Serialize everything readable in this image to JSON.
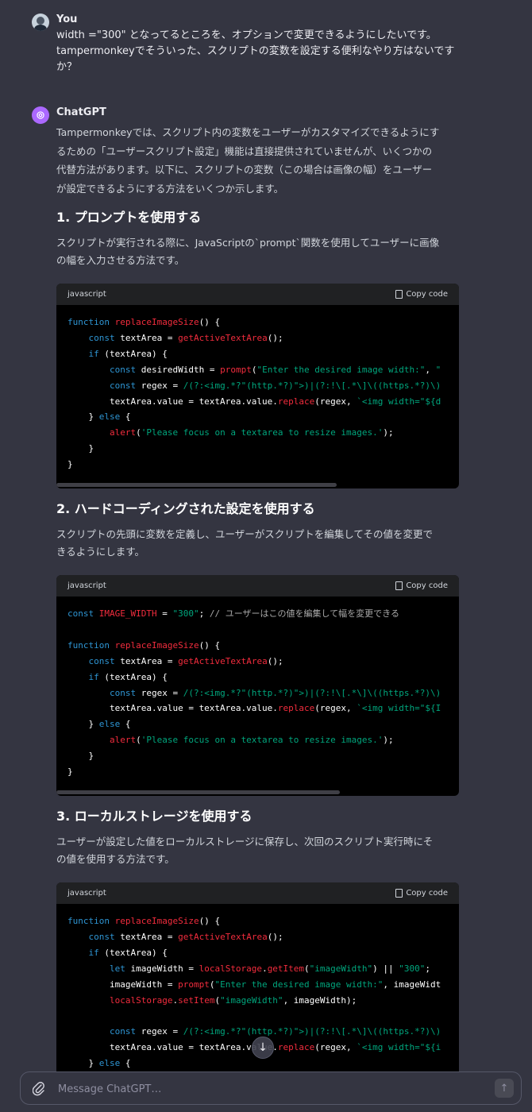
{
  "user_message": {
    "author": "You",
    "lines": [
      "width =\"300\" となってるところを、オプションで変更できるようにしたいです。",
      "tampermonkeyでそういった、スクリプトの変数を設定する便利なやり方はないです",
      "か？"
    ]
  },
  "assistant_message": {
    "author": "ChatGPT",
    "intro_lines": [
      "Tampermonkeyでは、スクリプト内の変数をユーザーがカスタマイズできるようにす",
      "るための「ユーザースクリプト設定」機能は直接提供されていませんが、いくつかの",
      "代替方法があります。以下に、スクリプトの変数（この場合は画像の幅）をユーザー",
      "が設定できるようにする方法をいくつか示します。"
    ],
    "sections": [
      {
        "heading": "1. プロンプトを使用する",
        "desc_lines": [
          "スクリプトが実行される際に、JavaScriptの`prompt`関数を使用してユーザーに画像",
          "の幅を入力させる方法です。"
        ],
        "code_lang": "javascript"
      },
      {
        "heading": "2. ハードコーディングされた設定を使用する",
        "desc_lines": [
          "スクリプトの先頭に変数を定義し、ユーザーがスクリプトを編集してその値を変更で",
          "きるようにします。"
        ],
        "code_lang": "javascript"
      },
      {
        "heading": "3. ローカルストレージを使用する",
        "desc_lines": [
          "ユーザーが設定した値をローカルストレージに保存し、次回のスクリプト実行時にそ",
          "の値を使用する方法です。"
        ],
        "code_lang": "javascript"
      }
    ]
  },
  "code_block": {
    "copy_label": "Copy code"
  },
  "composer": {
    "placeholder": "Message ChatGPT…"
  }
}
